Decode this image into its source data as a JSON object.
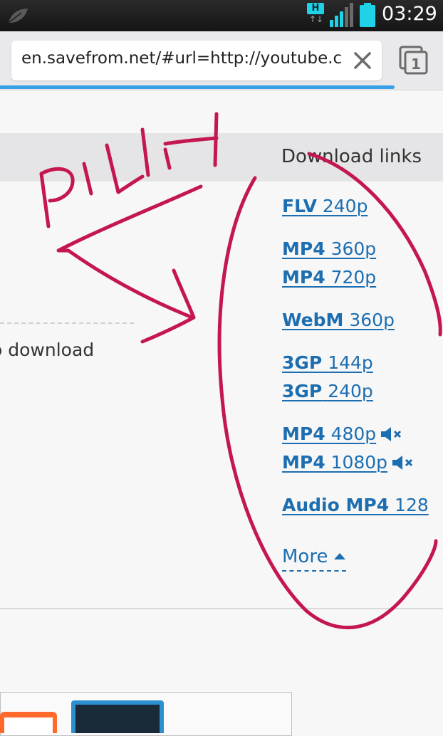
{
  "status_bar": {
    "network_badge": "H",
    "network_arrows": "↑↓",
    "time": "03:29"
  },
  "browser": {
    "url": "en.savefrom.net/#url=http://youtube.c",
    "tab_count": "1",
    "load_progress": 0.89
  },
  "page": {
    "header_title": "Download links",
    "left_text": "o download",
    "links": [
      {
        "format": "FLV",
        "quality": "240p",
        "muted": false
      },
      {
        "format": "MP4",
        "quality": "360p",
        "muted": false
      },
      {
        "format": "MP4",
        "quality": "720p",
        "muted": false
      },
      {
        "format": "WebM",
        "quality": "360p",
        "muted": false
      },
      {
        "format": "3GP",
        "quality": "144p",
        "muted": false
      },
      {
        "format": "3GP",
        "quality": "240p",
        "muted": false
      },
      {
        "format": "MP4",
        "quality": "480p",
        "muted": true
      },
      {
        "format": "MP4",
        "quality": "1080p",
        "muted": true
      },
      {
        "format": "Audio MP4",
        "quality": "128",
        "muted": false
      }
    ],
    "more_label": "More"
  },
  "handwriting": {
    "text": "PILIH",
    "color": "#c41750"
  },
  "icons": {
    "statusbar_leaf": "leaf-icon",
    "signal": "signal-icon",
    "battery": "battery-icon",
    "clear": "close-icon",
    "tabs": "tabs-icon",
    "mute": "mute-icon",
    "caret": "caret-up-icon"
  },
  "colors": {
    "link": "#1d6eb0",
    "accent": "#1fd2e8",
    "progress": "#3aa0e6"
  }
}
